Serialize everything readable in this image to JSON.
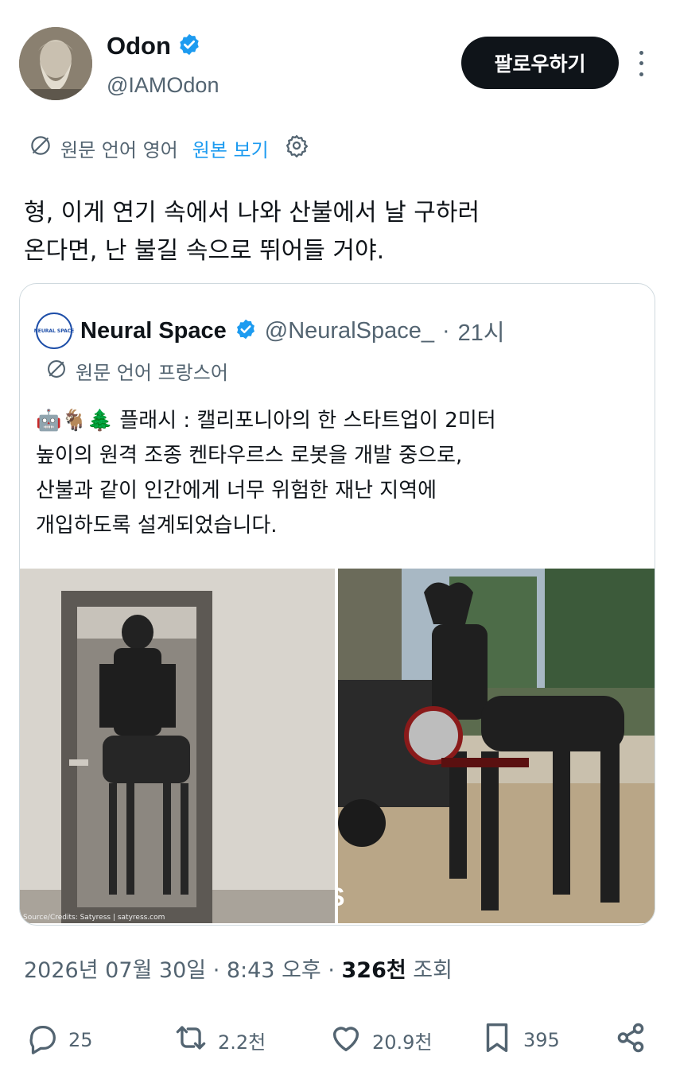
{
  "author": {
    "name": "Odon",
    "handle": "@IAMOdon",
    "follow_label": "팔로우하기"
  },
  "translate": {
    "original_lang_label": "원문 언어 영어",
    "view_original_label": "원본 보기"
  },
  "tweet": {
    "lines": [
      "형, 이게 연기 속에서 나와 산불에서 날 구하러",
      "온다면, 난 불길 속으로 뛰어들 거야."
    ]
  },
  "quote": {
    "name": "Neural Space",
    "handle": "@NeuralSpace_",
    "time": "21시",
    "separator": "·",
    "avatar_text": "NEURAL SPACE",
    "translate_label": "원문 언어 프랑스어",
    "emoji": "🤖🐐🌲",
    "lines": [
      "플래시 : 캘리포니아의 한 스타트업이 2미터",
      "높이의 원격 조종 켄타우르스 로봇을 개발 중으로,",
      "산불과 같이 인간에게 너무 위험한 재난 지역에",
      "개입하도록 설계되었습니다."
    ],
    "image_credit": "Source/Credits: Satyress | satyress.com",
    "watermark": "NS"
  },
  "meta": {
    "date_time": "2026년 07월 30일 · 8:43 오후 · ",
    "views": "326천",
    "views_label": "조회"
  },
  "actions": {
    "replies": "25",
    "retweets": "2.2천",
    "likes": "20.9천",
    "bookmarks": "395"
  },
  "colors": {
    "accent": "#1d9bf0",
    "text": "#0f1419",
    "muted": "#536471",
    "border": "#cfd9de"
  }
}
